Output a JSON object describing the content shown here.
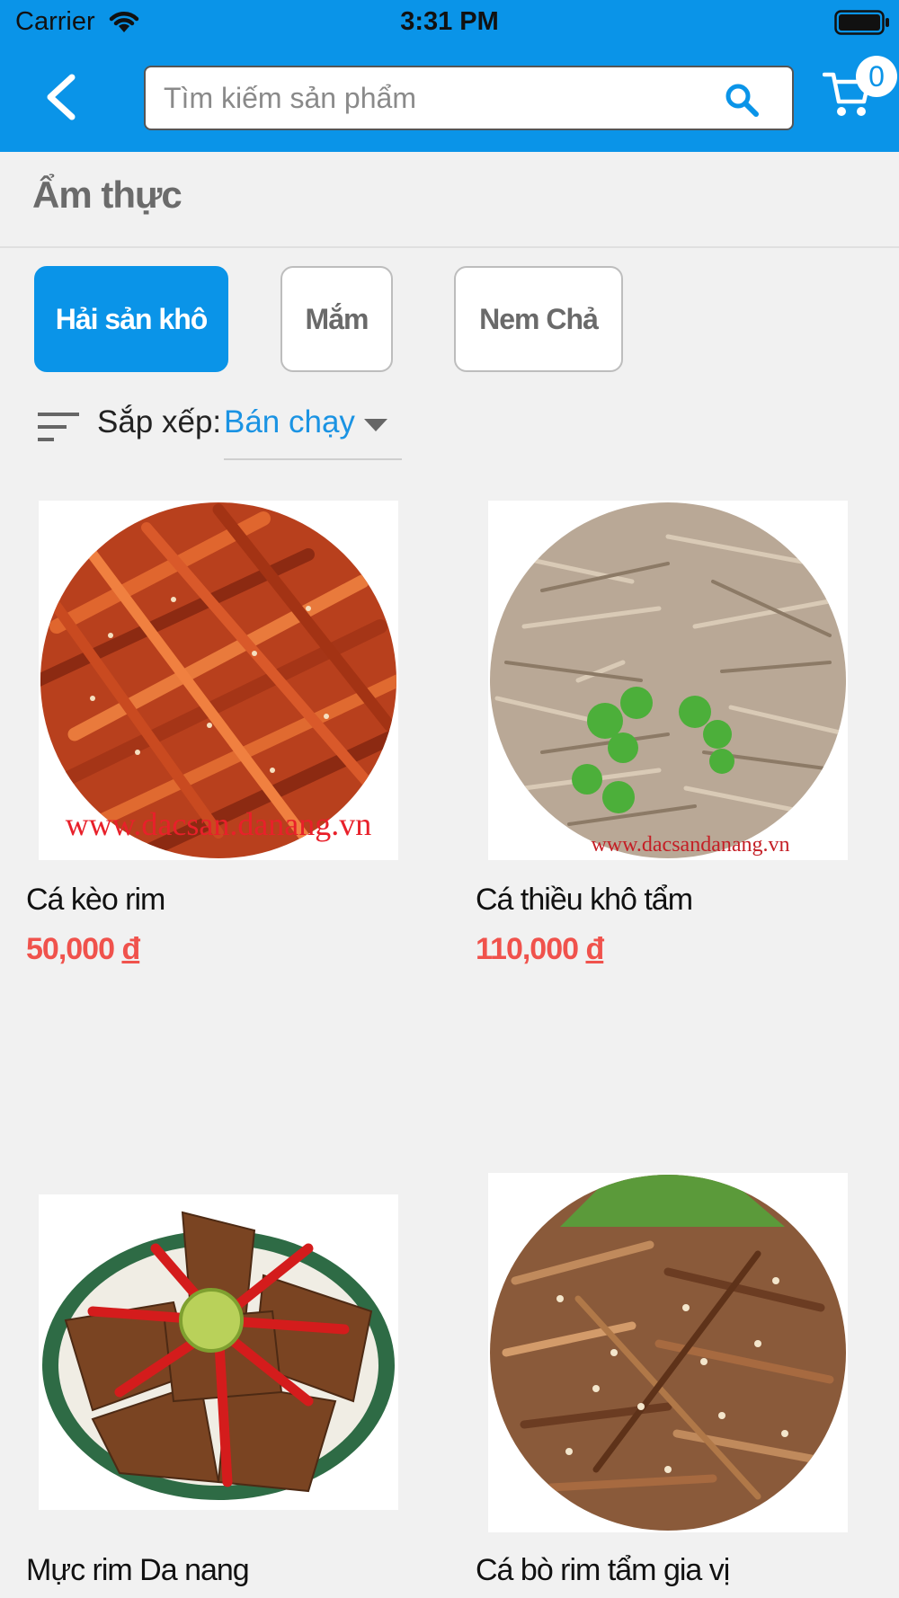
{
  "status_bar": {
    "carrier": "Carrier",
    "time": "3:31 PM"
  },
  "header": {
    "search_placeholder": "Tìm kiếm sản phẩm",
    "cart_count": "0"
  },
  "category": {
    "title": "Ẩm thực"
  },
  "subcategories": [
    {
      "label": "Hải sản khô",
      "active": true
    },
    {
      "label": "Mắm",
      "active": false
    },
    {
      "label": "Nem Chả",
      "active": false
    }
  ],
  "sort": {
    "label": "Sắp xếp:",
    "value": "Bán chạy"
  },
  "products": [
    {
      "name": "Cá kèo rim",
      "price": "50,000",
      "currency": "đ",
      "image_watermark": "www.dacsandanang.vn"
    },
    {
      "name": "Cá thiều khô tẩm",
      "price": "110,000",
      "currency": "đ",
      "image_watermark": "www.dacsandanang.vn"
    },
    {
      "name": "Mực rim Da nang"
    },
    {
      "name": "Cá bò rim tẩm gia vị"
    }
  ],
  "colors": {
    "primary": "#0a94e8",
    "price": "#f0524c",
    "sort_value": "#1a93e3"
  },
  "icons": [
    "wifi-icon",
    "battery-icon",
    "back-icon",
    "search-icon",
    "cart-icon",
    "sort-icon",
    "caret-down-icon"
  ]
}
